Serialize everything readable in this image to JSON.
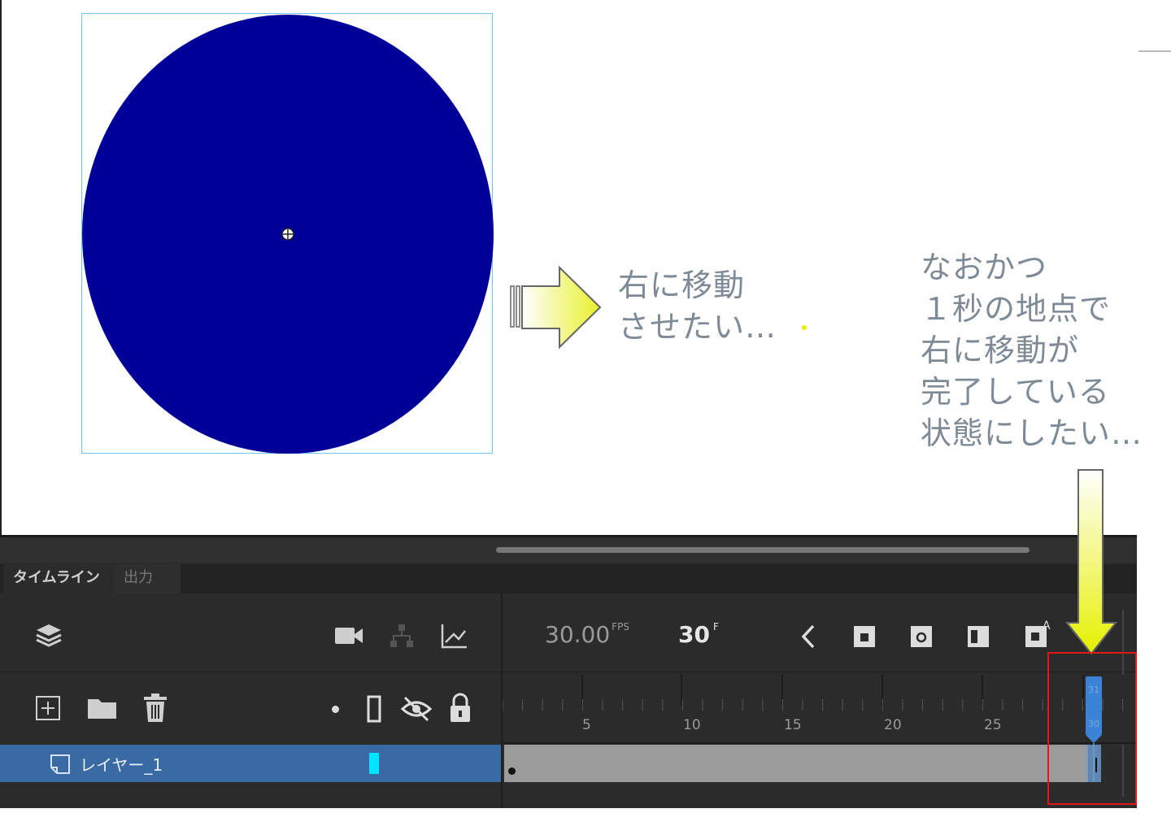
{
  "canvas": {
    "shape_fill": "#000099",
    "bbox_color": "#6fc7ef"
  },
  "notes": {
    "move_right": [
      "右に移動",
      "させたい…"
    ],
    "complete_at_one_second": [
      "なおかつ",
      "１秒の地点で",
      "右に移動が",
      "完了している",
      "状態にしたい…"
    ]
  },
  "timeline": {
    "tabs": [
      {
        "label": "タイムライン",
        "active": true
      },
      {
        "label": "出力",
        "active": false
      }
    ],
    "fps_value": "30.00",
    "fps_unit": "FPS",
    "current_frame": "30",
    "frame_unit": "F",
    "ruler_labels": [
      "5",
      "10",
      "15",
      "20",
      "25"
    ],
    "playhead_labels": [
      "31",
      "30"
    ],
    "layer": {
      "name": "レイヤー_1",
      "highlight_color": "#00e5ff"
    },
    "colors": {
      "panel": "#2b2b2b",
      "selected_layer": "#3a6aa3",
      "frames": "#9b9b9b",
      "playhead": "#3c82d6",
      "callout": "#e01818"
    }
  },
  "icons": {
    "layers": "layers-icon",
    "camera": "camera-icon",
    "parent": "layer-parenting-icon",
    "graph": "graph-icon",
    "prev": "previous-keyframe-icon",
    "insert_keyframe": "insert-keyframe-icon",
    "insert_blank_keyframe": "insert-blank-keyframe-icon",
    "onion_skin": "onion-skin-icon",
    "auto_keyframe": "auto-keyframe-icon",
    "new_layer": "new-layer-icon",
    "folder": "folder-icon",
    "trash": "trash-icon",
    "dot": "dot-icon",
    "outline": "outline-icon",
    "visibility": "eye-hidden-icon",
    "lock": "lock-icon",
    "layer_type": "layer-type-icon"
  }
}
